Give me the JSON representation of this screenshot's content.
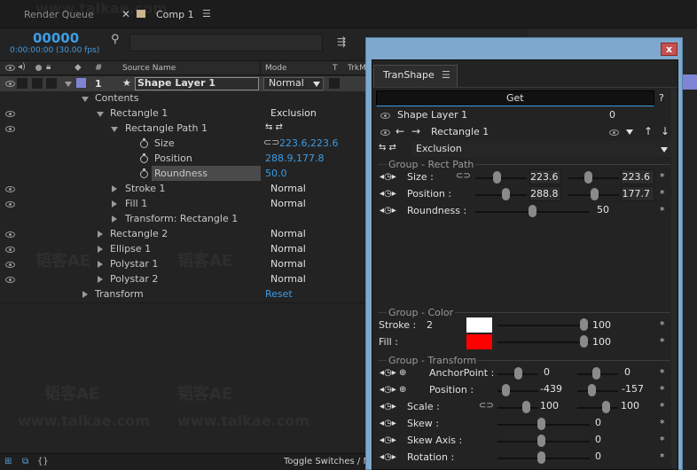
{
  "tabs": {
    "render_queue": "Render Queue",
    "comp": "Comp 1"
  },
  "timecode": {
    "value": "00000",
    "sub": "0:00:00:00 (30.00 fps)"
  },
  "columns": {
    "num": "#",
    "source_name": "Source Name",
    "mode": "Mode",
    "t": "T",
    "trkmat": "TrkM"
  },
  "layer": {
    "number": "1",
    "name": "Shape Layer 1",
    "mode": "Normal"
  },
  "tree": {
    "contents": "Contents",
    "rect1": "Rectangle 1",
    "rect1_mode": "Exclusion",
    "rect_path": "Rectangle Path 1",
    "size_label": "Size",
    "size_value": "223.6,223.6",
    "position_label": "Position",
    "position_value": "288.9,177.8",
    "roundness_label": "Roundness",
    "roundness_value": "50.0",
    "stroke1": "Stroke 1",
    "stroke1_mode": "Normal",
    "fill1": "Fill 1",
    "fill1_mode": "Normal",
    "transform_rect": "Transform: Rectangle 1",
    "rect2": "Rectangle 2",
    "rect2_mode": "Normal",
    "ellipse1": "Ellipse 1",
    "ellipse1_mode": "Normal",
    "polystar1": "Polystar 1",
    "polystar1_mode": "Normal",
    "polystar2": "Polystar 2",
    "polystar2_mode": "Normal",
    "transform": "Transform",
    "reset": "Reset"
  },
  "footer": {
    "toggle": "Toggle Switches / M"
  },
  "watermarks": [
    "www.talkae.com",
    "韬客AE"
  ],
  "panel": {
    "tab": "TranShape",
    "get": "Get",
    "help": "?",
    "layer_name": "Shape Layer 1",
    "layer_index": "0",
    "shape_name": "Rectangle 1",
    "blend_mode": "Exclusion",
    "group_rect": "Group - Rect Path",
    "size_label": "Size :",
    "size_x": "223.6",
    "size_y": "223.6",
    "position_label": "Position :",
    "position_x": "288.8",
    "position_y": "177.7",
    "roundness_label": "Roundness :",
    "roundness_value": "50",
    "group_color": "Group - Color",
    "stroke_label": "Stroke :",
    "stroke_width": "2",
    "stroke_color": "#ffffff",
    "stroke_opacity": "100",
    "fill_label": "Fill :",
    "fill_color": "#ff0000",
    "fill_opacity": "100",
    "group_transform": "Group - Transform",
    "anchor_label": "AnchorPoint :",
    "anchor_x": "0",
    "anchor_y": "0",
    "tposition_label": "Position :",
    "tposition_x": "-439",
    "tposition_y": "-157",
    "scale_label": "Scale :",
    "scale_x": "100",
    "scale_y": "100",
    "skew_label": "Skew :",
    "skew_value": "0",
    "skewaxis_label": "Skew Axis :",
    "skewaxis_value": "0",
    "rotation_label": "Rotation :",
    "rotation_value": "0",
    "star": "*",
    "close": "x"
  }
}
